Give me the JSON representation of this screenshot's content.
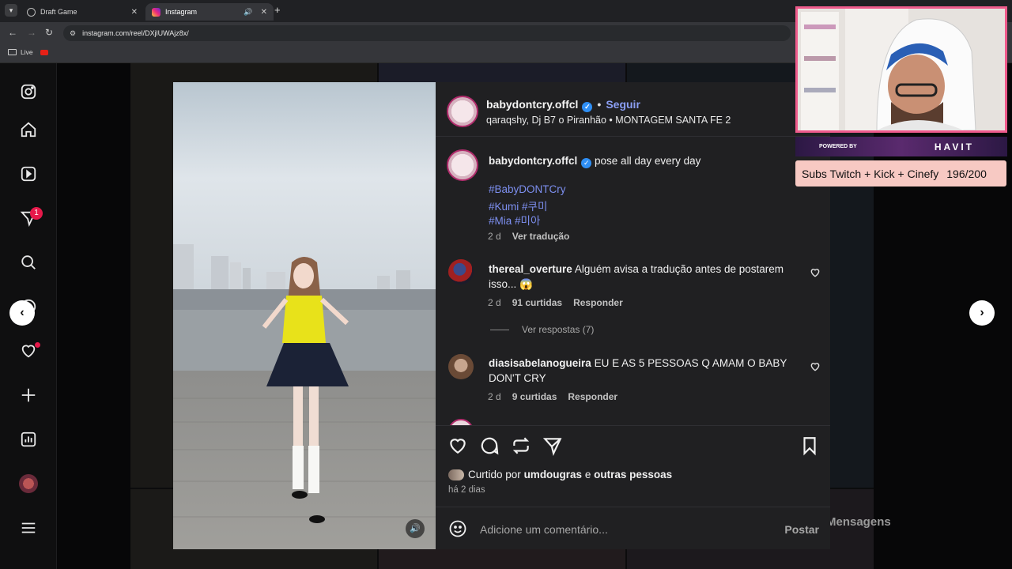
{
  "browser": {
    "tabs": [
      {
        "label": "Draft Game",
        "active": false
      },
      {
        "label": "Instagram",
        "active": true
      }
    ],
    "url": "instagram.com/reel/DXjlUWAjz8x/",
    "bookmarks": [
      {
        "label": "Live"
      }
    ]
  },
  "sidebar": {
    "notification_count": "1",
    "icons": [
      "instagram-logo-icon",
      "home-icon",
      "reels-icon",
      "messages-icon",
      "search-icon",
      "explore-icon",
      "notifications-icon",
      "create-icon",
      "dashboard-icon",
      "profile-icon",
      "menu-icon"
    ]
  },
  "post": {
    "author": "babydontcry.offcl",
    "follow_label": "Seguir",
    "audio": "qaraqshy, Dj B7 o Piranhão • MONTAGEM SANTA FE 2",
    "caption_author": "babydontcry.offcl",
    "caption_text": "pose all day every day",
    "hashtags": [
      "#BabyDONTCry",
      "#Kumi #쿠미",
      "#Mia #미아"
    ],
    "caption_age": "2 d",
    "translate_label": "Ver tradução",
    "liked_by_prefix": "Curtido por ",
    "liked_by_user": "umdougras",
    "liked_by_mid": " e ",
    "liked_by_rest": "outras pessoas",
    "posted_ago": "há 2 dias",
    "comment_placeholder": "Adicione um comentário...",
    "post_button": "Postar"
  },
  "comments": [
    {
      "user": "thereal_overture",
      "text": "Alguém avisa a tradução antes de postarem isso... 😱",
      "age": "2 d",
      "likes": "91 curtidas",
      "reply_label": "Responder",
      "view_replies": "Ver respostas (7)"
    },
    {
      "user": "diasisabelanogueira",
      "text": "EU E AS 5 PESSOAS Q AMAM O BABY DON'T CRY",
      "age": "2 d",
      "likes": "9 curtidas",
      "reply_label": "Responder"
    }
  ],
  "background": {
    "messages_label": "Mensagens"
  },
  "overlay": {
    "sponsor_powered": "POWERED BY",
    "sponsor_brand": "HAVIT",
    "subs_label": "Subs Twitch + Kick + Cinefy",
    "subs_count": "196/200"
  },
  "colors": {
    "accent_link": "#7d8ff0",
    "verified": "#2f8ff5",
    "panel_bg": "#202022",
    "overlay_pink": "#ef5b8c",
    "subs_bg": "#f7c9c3"
  }
}
